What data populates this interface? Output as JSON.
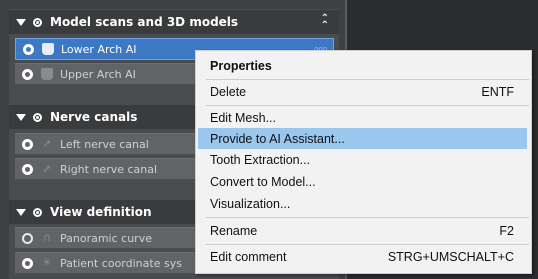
{
  "groups": [
    {
      "title": "Model scans and 3D models",
      "collapse_icon": "chevrons-up-icon"
    },
    {
      "title": "Nerve canals"
    },
    {
      "title": "View definition"
    }
  ],
  "rows": [
    {
      "label": "Lower Arch AI",
      "icon": "tooth-icon",
      "selected": true,
      "dots": "ooo"
    },
    {
      "label": "Upper Arch AI",
      "icon": "tooth-icon"
    },
    {
      "label": "Left nerve canal",
      "icon": "curve-icon"
    },
    {
      "label": "Right nerve canal",
      "icon": "curve-icon"
    },
    {
      "label": "Panoramic curve",
      "icon": "arc-icon"
    },
    {
      "label": "Patient coordinate sys",
      "icon": "axes-icon"
    }
  ],
  "context_menu": {
    "items": [
      {
        "label": "Properties",
        "shortcut": ""
      },
      {
        "label": "Delete",
        "shortcut": "ENTF"
      },
      {
        "label": "Edit Mesh...",
        "shortcut": ""
      },
      {
        "label": "Provide to AI Assistant...",
        "shortcut": "",
        "highlighted": true
      },
      {
        "label": "Tooth Extraction...",
        "shortcut": ""
      },
      {
        "label": "Convert to Model...",
        "shortcut": ""
      },
      {
        "label": "Visualization...",
        "shortcut": ""
      },
      {
        "label": "Rename",
        "shortcut": "F2"
      },
      {
        "label": "Edit comment",
        "shortcut": "STRG+UMSCHALT+C"
      }
    ]
  }
}
